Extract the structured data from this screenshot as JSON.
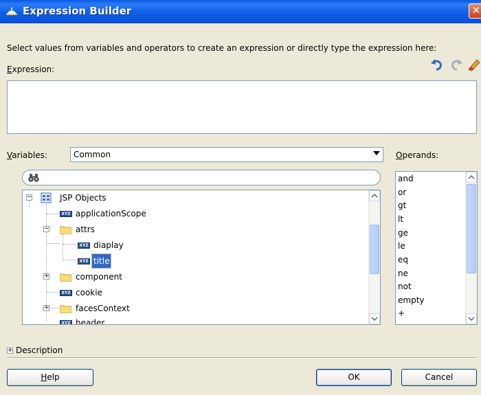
{
  "window": {
    "title": "Expression Builder",
    "close_glyph": "✕"
  },
  "prompt": "Select values from variables and operators to create an expression or directly type the expression here:",
  "expression": {
    "label_prefix": "",
    "label_mnemonic": "E",
    "label_rest": "xpression:",
    "value": "",
    "tools": [
      {
        "icon": "undo-icon"
      },
      {
        "icon": "redo-icon"
      },
      {
        "icon": "eraser-icon"
      }
    ]
  },
  "variables": {
    "label_mnemonic": "V",
    "label_rest": "ariables:",
    "selected": "Common"
  },
  "search": {
    "icon": "binoculars-icon",
    "value": ""
  },
  "tree": {
    "items": [
      {
        "label": "JSP Objects",
        "icon": "jsp-objects-icon",
        "state": "expanded"
      },
      {
        "label": "applicationScope",
        "icon": "variable-icon"
      },
      {
        "label": "attrs",
        "icon": "folder-icon",
        "state": "expanded"
      },
      {
        "label": "diaplay",
        "icon": "variable-icon"
      },
      {
        "label": "title",
        "icon": "variable-icon",
        "selected": true
      },
      {
        "label": "component",
        "icon": "folder-icon",
        "state": "collapsed"
      },
      {
        "label": "cookie",
        "icon": "variable-icon"
      },
      {
        "label": "facesContext",
        "icon": "folder-icon",
        "state": "collapsed"
      },
      {
        "label": "header",
        "icon": "variable-icon"
      }
    ],
    "badge_text": "XYZ"
  },
  "operands": {
    "label_mnemonic": "O",
    "label_rest": "perands:",
    "items": [
      "and",
      "or",
      "gt",
      "lt",
      "ge",
      "le",
      "eq",
      "ne",
      "not",
      "empty",
      "+"
    ]
  },
  "description": {
    "label": "Description",
    "expander": "+"
  },
  "buttons": {
    "help_mnemonic": "H",
    "help_rest": "elp",
    "ok": "OK",
    "cancel": "Cancel"
  },
  "colors": {
    "titlebar": "#0b4fd8",
    "selection": "#316ac5",
    "dialog_bg": "#ece9d8"
  }
}
